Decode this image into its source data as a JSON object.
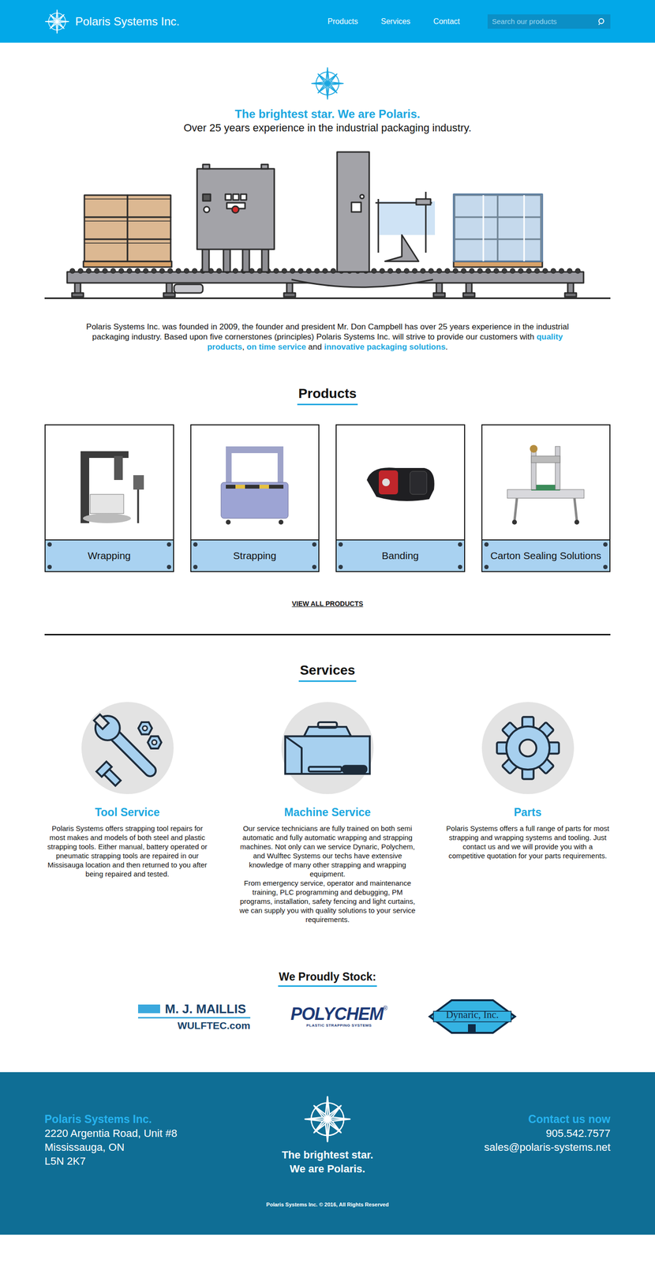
{
  "header": {
    "brand": "Polaris Systems Inc.",
    "nav": [
      "Products",
      "Services",
      "Contact"
    ],
    "search": {
      "placeholder": "Search our products"
    }
  },
  "hero": {
    "tagline": "The brightest star. We are Polaris.",
    "subtitle": "Over 25 years experience in the industrial packaging industry.",
    "intro": [
      {
        "text": "Polaris Systems Inc. was founded in 2009, the founder and president Mr. Don Campbell has over 25 years experience in the industrial packaging industry. Based upon five cornerstones (principles) Polaris Systems Inc. will strive to provide our customers with ",
        "highlight": false
      },
      {
        "text": "quality products",
        "highlight": true
      },
      {
        "text": ", ",
        "highlight": false
      },
      {
        "text": "on time service",
        "highlight": true
      },
      {
        "text": " and ",
        "highlight": false
      },
      {
        "text": "innovative packaging solutions",
        "highlight": true
      },
      {
        "text": ".",
        "highlight": false
      }
    ]
  },
  "products": {
    "heading": "Products",
    "items": [
      {
        "label": "Wrapping",
        "kind": "wrapping"
      },
      {
        "label": "Strapping",
        "kind": "strapping"
      },
      {
        "label": "Banding",
        "kind": "banding"
      },
      {
        "label": "Carton Sealing Solutions",
        "kind": "sealing"
      }
    ],
    "view_all": "VIEW ALL PRODUCTS"
  },
  "services": {
    "heading": "Services",
    "items": [
      {
        "title": "Tool Service",
        "kind": "tool",
        "paragraphs": [
          "Polaris Systems offers strapping tool repairs for most makes and models of both steel and plastic strapping tools. Either manual, battery operated or pneumatic strapping tools are repaired in our Missisauga location and then returned to you after being repaired and tested."
        ]
      },
      {
        "title": "Machine Service",
        "kind": "machine",
        "paragraphs": [
          "Our service technicians are fully trained on both semi automatic and fully automatic wrapping and strapping machines. Not only can we service Dynaric, Polychem, and Wulftec Systems our techs have extensive knowledge of many other strapping and wrapping equipment.",
          "From emergency service, operator and maintenance training, PLC programming and debugging, PM programs, installation, safety fencing and light curtains, we can supply you with quality solutions to your service requirements."
        ]
      },
      {
        "title": "Parts",
        "kind": "parts",
        "paragraphs": [
          "Polaris Systems offers a full range of parts for most strapping and wrapping systems and tooling. Just contact us and we will provide you with a competitive quotation for your parts requirements."
        ]
      }
    ]
  },
  "stock": {
    "heading": "We Proudly Stock:",
    "logos": [
      {
        "kind": "maillis",
        "lines": [
          "M. J. MAILLIS",
          "WULFTEC.com"
        ]
      },
      {
        "kind": "polychem",
        "lines": [
          "POLYCHEM",
          "®",
          "PLASTIC STRAPPING SYSTEMS"
        ]
      },
      {
        "kind": "dynaric",
        "lines": [
          "Dynaric, Inc."
        ]
      }
    ]
  },
  "footer": {
    "company": "Polaris Systems Inc.",
    "address": [
      "2220 Argentia Road, Unit #8",
      "Mississauga, ON",
      "L5N 2K7"
    ],
    "tagline": [
      "The brightest star.",
      "We are Polaris."
    ],
    "contact_heading": "Contact us now",
    "phone": "905.542.7577",
    "email": "sales@polaris-systems.net",
    "copyright": "Polaris Systems Inc. © 2016, All Rights Reserved"
  }
}
